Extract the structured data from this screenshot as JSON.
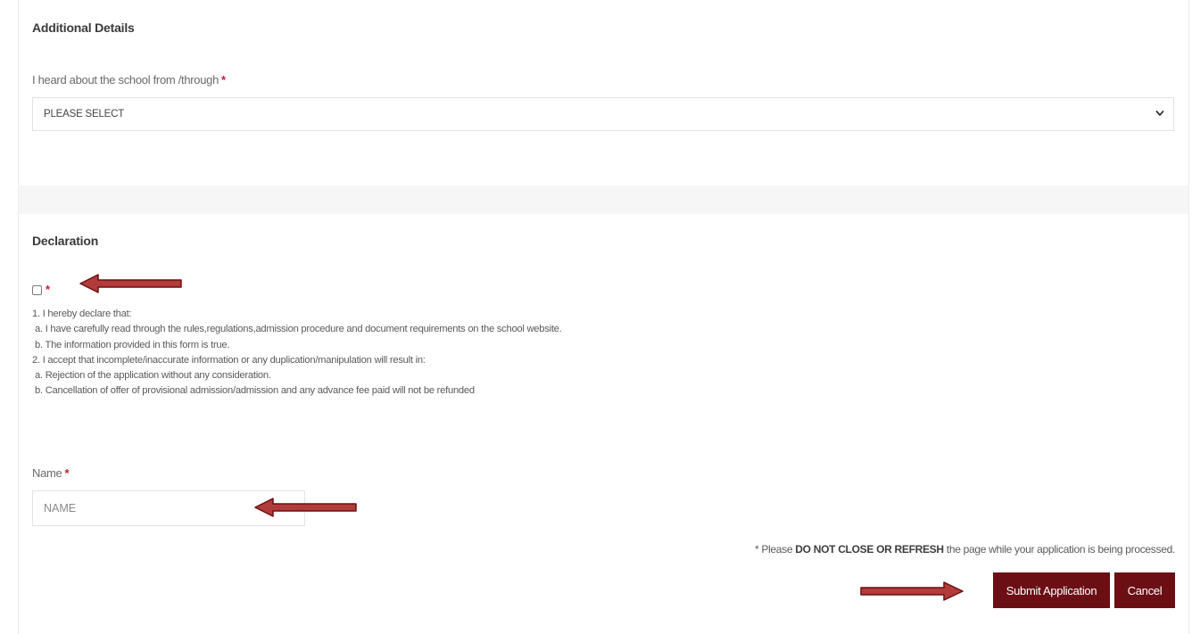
{
  "additional_details": {
    "heading": "Additional Details",
    "source_label": "I heard about the school from /through",
    "required_mark": "*",
    "source_selected": "PLEASE SELECT"
  },
  "declaration": {
    "heading": "Declaration",
    "checkbox_required_mark": "*",
    "checked": false,
    "lines": [
      "1. I hereby declare that:",
      "a. I have carefully read through the rules,regulations,admission procedure and document requirements on the school website.",
      "b. The information provided in this form is true.",
      "2. I accept that incomplete/inaccurate information or any duplication/manipulation will result in:",
      "a. Rejection of the application without any consideration.",
      "b. Cancellation of offer of provisional admission/admission and any advance fee paid will not be refunded"
    ]
  },
  "name_field": {
    "label": "Name",
    "required_mark": "*",
    "placeholder": "NAME",
    "value": ""
  },
  "notice": {
    "prefix": "* Please ",
    "emphasis": "DO NOT CLOSE OR REFRESH",
    "suffix": " the page while your application is being processed."
  },
  "actions": {
    "submit_label": "Submit Application",
    "cancel_label": "Cancel"
  },
  "colors": {
    "button_bg": "#6b0f15",
    "required": "#cc1b2a",
    "arrow_fill": "#b23b3b",
    "arrow_stroke": "#6a1010"
  },
  "icons": {
    "select_chevron": "chevron-down-icon",
    "annotation": "arrow-icon"
  }
}
